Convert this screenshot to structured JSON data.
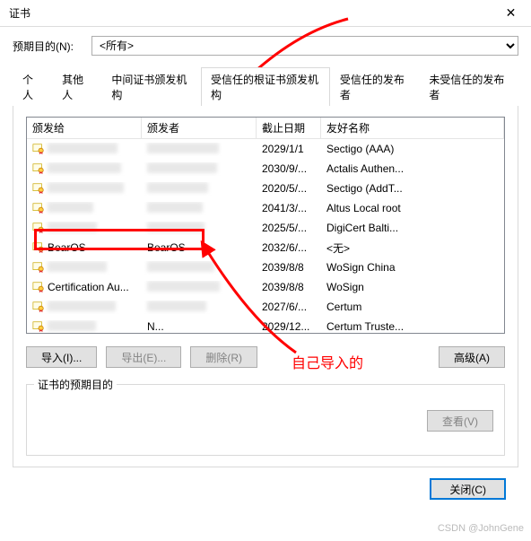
{
  "window": {
    "title": "证书",
    "close_label": "✕"
  },
  "purpose": {
    "label": "预期目的(N):",
    "option": "<所有>"
  },
  "tabs": {
    "items": [
      "个人",
      "其他人",
      "中间证书颁发机构",
      "受信任的根证书颁发机构",
      "受信任的发布者",
      "未受信任的发布者"
    ],
    "active_index": 3
  },
  "columns": {
    "c1": "颁发给",
    "c2": "颁发者",
    "c3": "截止日期",
    "c4": "友好名称"
  },
  "rows": [
    {
      "issued_to": "",
      "issuer": "",
      "expires": "2029/1/1",
      "friendly": "Sectigo (AAA)",
      "blur": true
    },
    {
      "issued_to": "",
      "issuer": "",
      "expires": "2030/9/...",
      "friendly": "Actalis Authen...",
      "blur": true
    },
    {
      "issued_to": "",
      "issuer": "",
      "expires": "2020/5/...",
      "friendly": "Sectigo (AddT...",
      "blur": true
    },
    {
      "issued_to": "",
      "issuer": "",
      "expires": "2041/3/...",
      "friendly": "Altus Local root",
      "blur": true
    },
    {
      "issued_to": "",
      "issuer": "",
      "expires": "2025/5/...",
      "friendly": "DigiCert Balti...",
      "blur": true
    },
    {
      "issued_to": "BearOS",
      "issuer": "BearOS",
      "expires": "2032/6/...",
      "friendly": "<无>",
      "highlight": true
    },
    {
      "issued_to": "",
      "issuer": "",
      "expires": "2039/8/8",
      "friendly": "WoSign China",
      "blur": true
    },
    {
      "issued_to": "Certification Au...",
      "issuer": "",
      "expires": "2039/8/8",
      "friendly": "WoSign",
      "blur": true
    },
    {
      "issued_to": "",
      "issuer": "",
      "expires": "2027/6/...",
      "friendly": "Certum",
      "blur": true
    },
    {
      "issued_to": "",
      "issuer": "N...",
      "expires": "2029/12...",
      "friendly": "Certum Truste...",
      "blur": true
    }
  ],
  "buttons": {
    "import": "导入(I)...",
    "export": "导出(E)...",
    "remove": "删除(R)",
    "advanced": "高级(A)",
    "view": "查看(V)",
    "close": "关闭(C)"
  },
  "group": {
    "title": "证书的预期目的"
  },
  "annotation": "自己导入的",
  "watermark": "CSDN @JohnGene"
}
